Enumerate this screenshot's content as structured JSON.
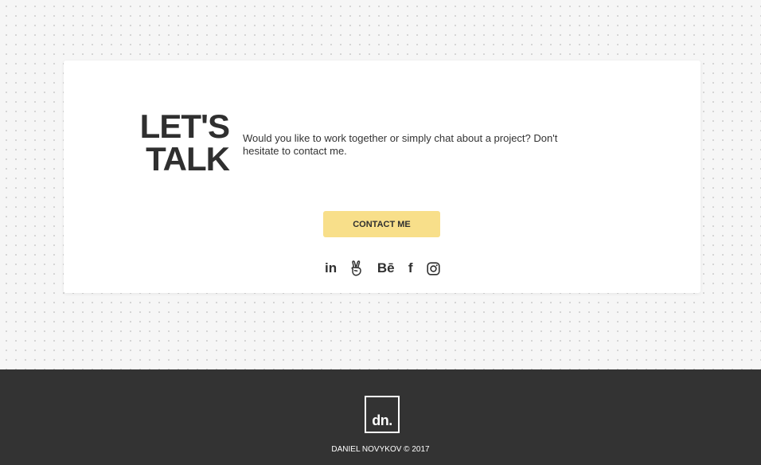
{
  "contact": {
    "heading_line1": "LET'S",
    "heading_line2": "TALK",
    "intro": "Would you like to work together or simply chat about a project? Don't hesitate to contact me.",
    "button_label": "CONTACT ME",
    "accent_color": "#f8df8a"
  },
  "socials": [
    {
      "icon": "linkedin-icon",
      "text": "in"
    },
    {
      "icon": "angellist-icon"
    },
    {
      "icon": "behance-icon",
      "text": "Bē"
    },
    {
      "icon": "facebook-icon",
      "text": "f"
    },
    {
      "icon": "instagram-icon"
    }
  ],
  "footer": {
    "logo_text": "dn.",
    "copyright": "DANIEL NOVYKOV © 2017",
    "background_color": "#333333"
  }
}
